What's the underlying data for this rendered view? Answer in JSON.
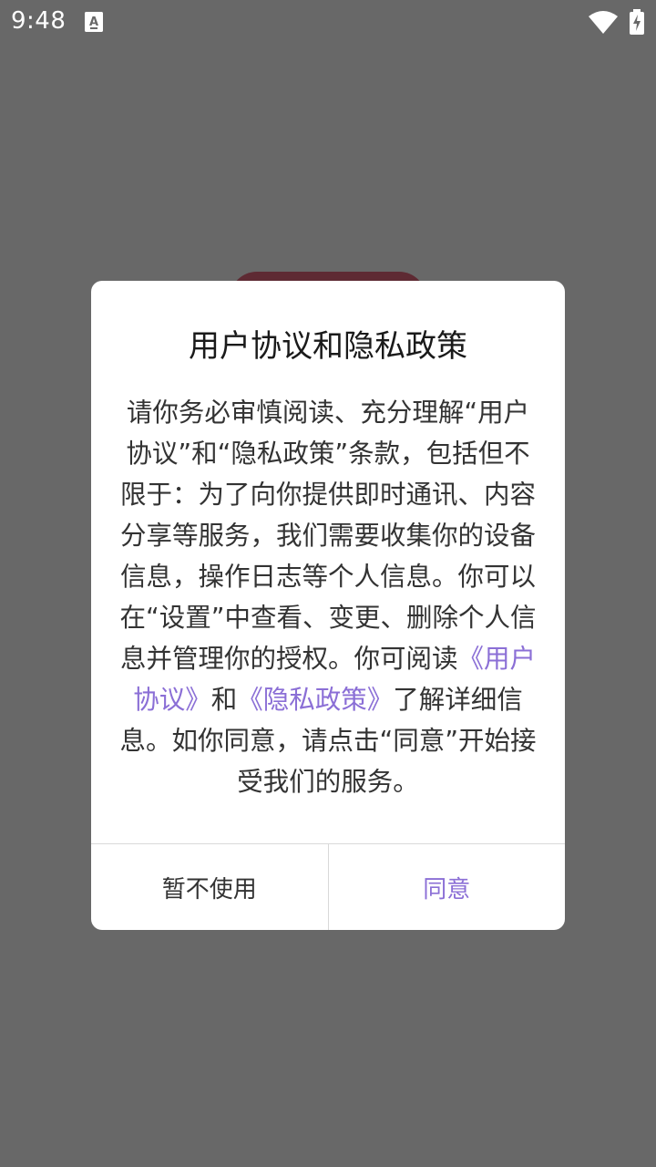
{
  "status_bar": {
    "time": "9:48",
    "notification_icon": "a-notification-icon",
    "wifi_icon": "wifi-icon",
    "battery_icon": "battery-charging-icon"
  },
  "dialog": {
    "title": "用户协议和隐私政策",
    "body_part1": "请你务必审慎阅读、充分理解“用户协议”和“隐私政策”条款，包括但不限于：为了向你提供即时通讯、内容分享等服务，我们需要收集你的设备信息，操作日志等个人信息。你可以在“设置”中查看、变更、删除个人信息并管理你的授权。你可阅读",
    "link_user_agreement": "《用户协议》",
    "body_and": "和",
    "link_privacy_policy": "《隐私政策》",
    "body_part2": "了解详细信息。如你同意，请点击“同意”开始接受我们的服务。",
    "decline_label": "暂不使用",
    "agree_label": "同意"
  },
  "colors": {
    "overlay": "#686868",
    "link": "#8b6fd6",
    "background_element": "#5e2a33"
  }
}
